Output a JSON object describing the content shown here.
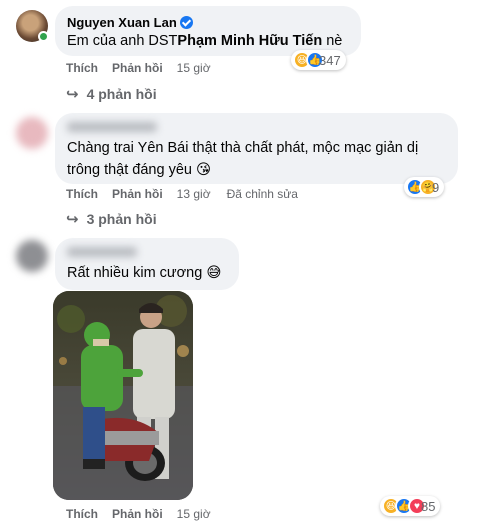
{
  "comments": [
    {
      "author": "Nguyen Xuan Lan",
      "verified": true,
      "text_prefix": "Em của anh DST",
      "tag": "Phạm Minh Hữu Tiến",
      "text_suffix": " nè",
      "actions": {
        "like": "Thích",
        "reply": "Phản hồi",
        "time": "15 giờ"
      },
      "reactions": {
        "icons": [
          "haha",
          "like"
        ],
        "count": "347"
      },
      "replies": "4 phản hồi"
    },
    {
      "author_blurred": true,
      "text_line1": "Chàng trai Yên Bái thật thà chất phát, mộc mạc giản dị",
      "text_line2": "trông thật đáng yêu",
      "actions": {
        "like": "Thích",
        "reply": "Phản hồi",
        "time": "13 giờ",
        "edited": "Đã chỉnh sửa"
      },
      "reactions": {
        "icons": [
          "like",
          "care"
        ],
        "count": "9"
      },
      "replies": "3 phản hồi"
    },
    {
      "author_blurred": true,
      "text": "Rất nhiều kim cương",
      "actions": {
        "like": "Thích",
        "reply": "Phản hồi",
        "time": "15 giờ"
      },
      "reactions": {
        "icons": [
          "haha",
          "like",
          "love"
        ],
        "count": "85"
      }
    }
  ],
  "colors": {
    "bubble": "#f0f2f5",
    "meta": "#65676b",
    "like": "#1877f2",
    "haha": "#f7b125",
    "love": "#f33e58",
    "online": "#31a24c"
  }
}
